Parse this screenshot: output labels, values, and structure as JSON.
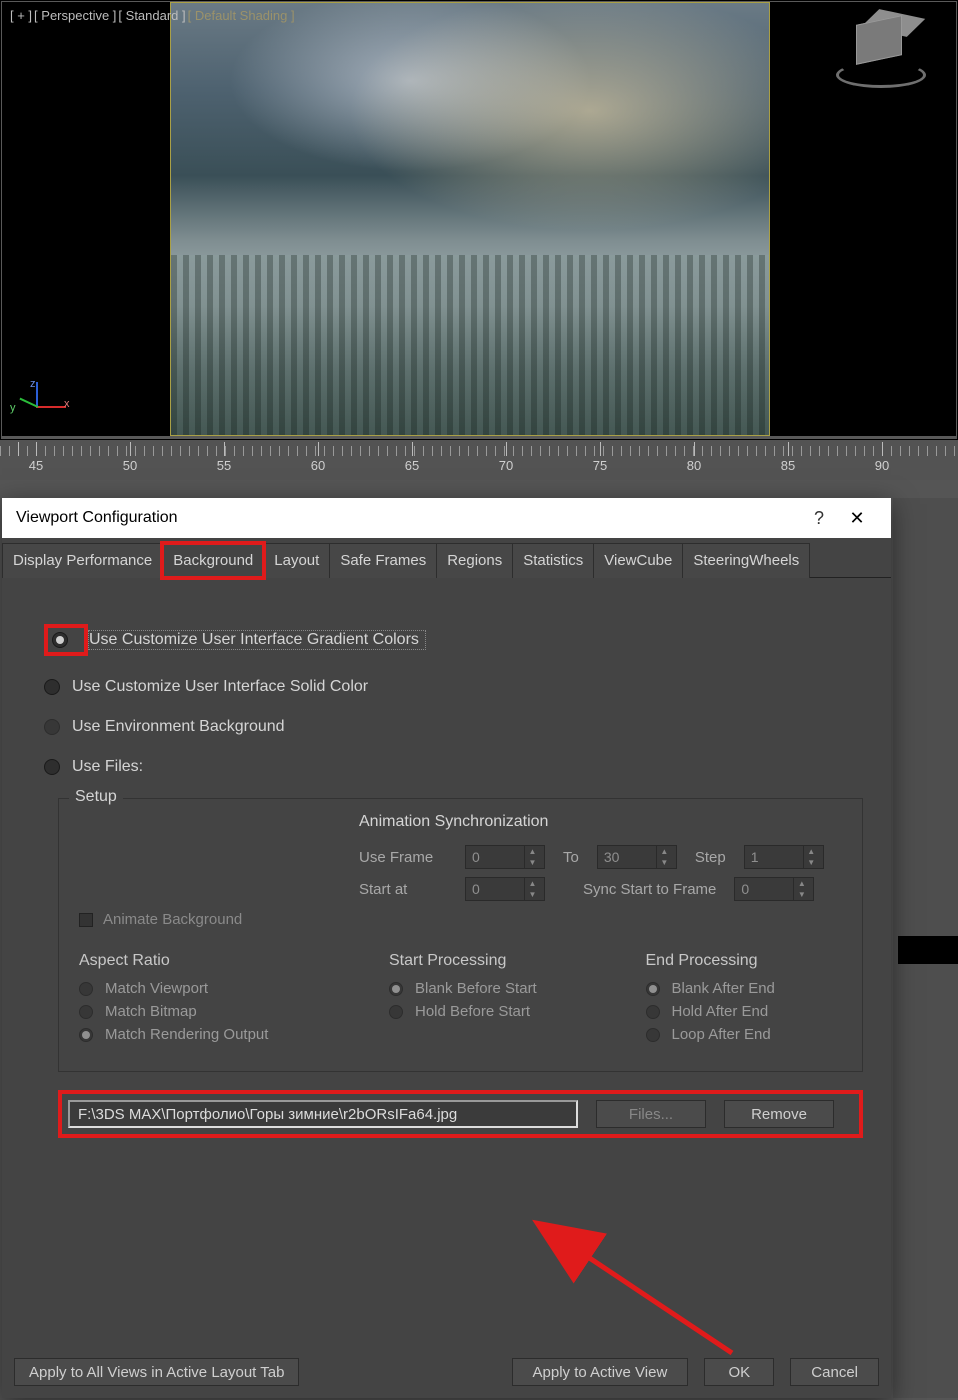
{
  "viewport": {
    "labels": {
      "plus": "[ + ]",
      "view": "[ Perspective ]",
      "mode": "[ Standard ]",
      "shade": "[ Default Shading ]"
    },
    "axes": {
      "x": "x",
      "y": "y",
      "z": "z"
    }
  },
  "ruler_marks": [
    "45",
    "50",
    "55",
    "60",
    "65",
    "70",
    "75",
    "80",
    "85",
    "90"
  ],
  "dialog": {
    "title": "Viewport Configuration",
    "tabs": [
      "Display Performance",
      "Background",
      "Layout",
      "Safe Frames",
      "Regions",
      "Statistics",
      "ViewCube",
      "SteeringWheels"
    ],
    "active_tab": 1,
    "options": {
      "opt_gradient": "Use Customize User Interface Gradient Colors",
      "opt_solid": "Use Customize User Interface Solid Color",
      "opt_env": "Use Environment Background",
      "opt_files": "Use Files:"
    },
    "setup": {
      "label": "Setup",
      "anim_sync": "Animation Synchronization",
      "use_frame_lbl": "Use Frame",
      "use_frame_val": "0",
      "to_lbl": "To",
      "to_val": "30",
      "step_lbl": "Step",
      "step_val": "1",
      "start_at_lbl": "Start at",
      "start_at_val": "0",
      "sync_lbl": "Sync Start to Frame",
      "sync_val": "0",
      "animate_bg": "Animate Background",
      "aspect": {
        "title": "Aspect Ratio",
        "match_viewport": "Match Viewport",
        "match_bitmap": "Match Bitmap",
        "match_render": "Match Rendering Output"
      },
      "start_proc": {
        "title": "Start Processing",
        "blank": "Blank Before Start",
        "hold": "Hold Before Start"
      },
      "end_proc": {
        "title": "End Processing",
        "blank": "Blank After End",
        "hold": "Hold After End",
        "loop": "Loop After End"
      },
      "file_path": "F:\\3DS MAX\\Портфолио\\Горы зимние\\r2bORsIFa64.jpg",
      "files_btn": "Files...",
      "remove_btn": "Remove"
    },
    "footer": {
      "apply_all": "Apply to All Views in Active Layout Tab",
      "apply_active": "Apply to Active View",
      "ok": "OK",
      "cancel": "Cancel"
    }
  }
}
